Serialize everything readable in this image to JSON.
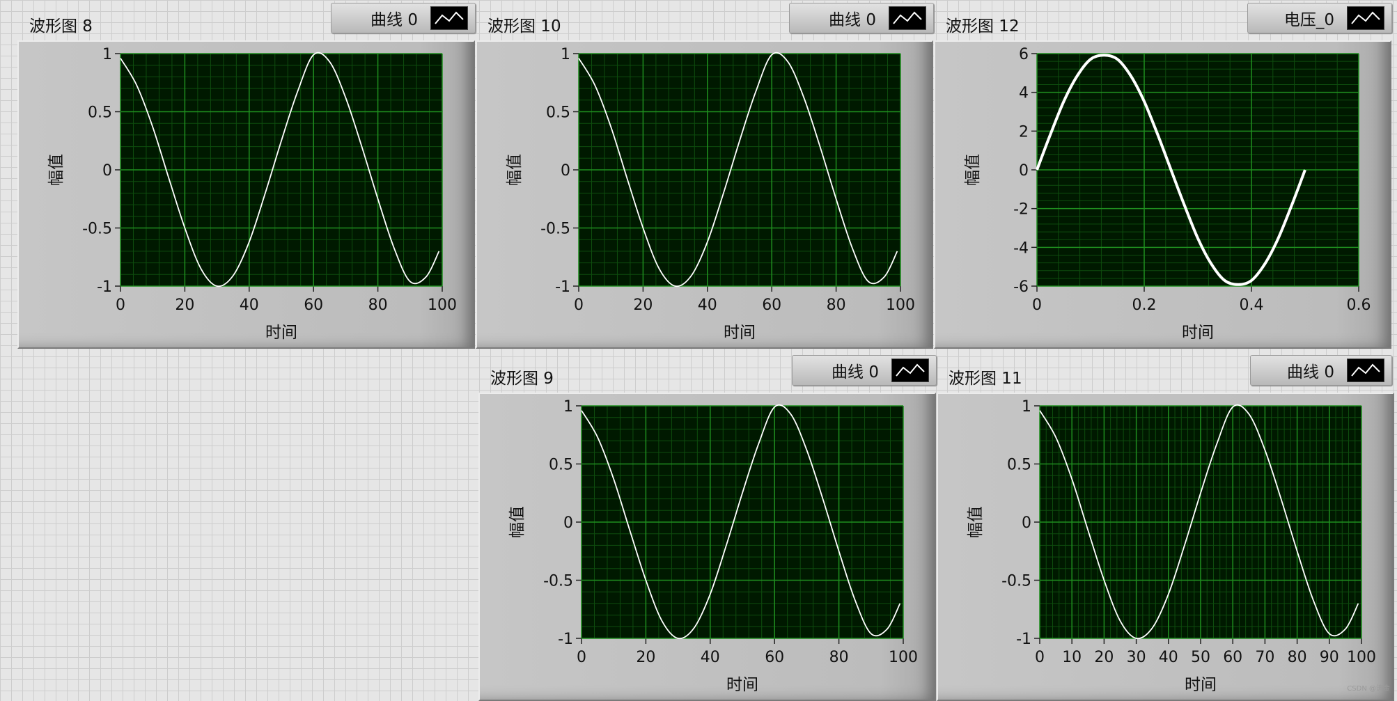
{
  "colors": {
    "plot_background": "#001900",
    "grid_major": "#1f8f1f",
    "grid_minor": "#0e4d0e",
    "trace": "#ffffff"
  },
  "graphs": [
    {
      "id": "g8",
      "label": "波形图 8",
      "legend": "曲线 0",
      "legend_icon": "line-plot-icon",
      "chart_data": {
        "type": "line",
        "xlabel": "时间",
        "ylabel": "幅值",
        "xlim": [
          0,
          100
        ],
        "ylim": [
          -1,
          1
        ],
        "xticks": [
          0,
          20,
          40,
          60,
          80,
          100
        ],
        "yticks": [
          -1,
          -0.5,
          0,
          0.5,
          1
        ],
        "xtick_labels": [
          "0",
          "20",
          "40",
          "60",
          "80",
          "100"
        ],
        "ytick_labels": [
          "-1",
          "-0.5",
          "0",
          "0.5",
          "1"
        ],
        "series": [
          {
            "x": [
              0,
              5,
              10,
              15,
              20,
              25,
              30,
              35,
              40,
              45,
              50,
              55,
              60,
              65,
              70,
              75,
              80,
              85,
              90,
              95,
              99
            ],
            "y": [
              0.96,
              0.73,
              0.37,
              -0.07,
              -0.5,
              -0.85,
              -1.0,
              -0.91,
              -0.62,
              -0.2,
              0.25,
              0.67,
              0.99,
              0.93,
              0.62,
              0.2,
              -0.25,
              -0.67,
              -0.96,
              -0.92,
              -0.7
            ]
          }
        ]
      }
    },
    {
      "id": "g10",
      "label": "波形图 10",
      "legend": "曲线 0",
      "legend_icon": "line-plot-icon",
      "chart_data": {
        "type": "line",
        "xlabel": "时间",
        "ylabel": "幅值",
        "xlim": [
          0,
          100
        ],
        "ylim": [
          -1,
          1
        ],
        "xticks": [
          0,
          20,
          40,
          60,
          80,
          100
        ],
        "yticks": [
          -1,
          -0.5,
          0,
          0.5,
          1
        ],
        "xtick_labels": [
          "0",
          "20",
          "40",
          "60",
          "80",
          "100"
        ],
        "ytick_labels": [
          "-1",
          "-0.5",
          "0",
          "0.5",
          "1"
        ],
        "series": [
          {
            "x": [
              0,
              5,
              10,
              15,
              20,
              25,
              30,
              35,
              40,
              45,
              50,
              55,
              60,
              65,
              70,
              75,
              80,
              85,
              90,
              95,
              99
            ],
            "y": [
              0.96,
              0.73,
              0.37,
              -0.07,
              -0.5,
              -0.85,
              -1.0,
              -0.91,
              -0.62,
              -0.2,
              0.25,
              0.67,
              0.99,
              0.93,
              0.62,
              0.2,
              -0.25,
              -0.67,
              -0.96,
              -0.92,
              -0.7
            ]
          }
        ]
      }
    },
    {
      "id": "g12",
      "label": "波形图 12",
      "legend": "电压_0",
      "legend_icon": "line-plot-icon",
      "chart_data": {
        "type": "line",
        "xlabel": "时间",
        "ylabel": "幅值",
        "xlim": [
          0,
          0.6
        ],
        "ylim": [
          -6,
          6
        ],
        "xticks": [
          0,
          0.2,
          0.4,
          0.6
        ],
        "yticks": [
          -6,
          -4,
          -2,
          0,
          2,
          4,
          6
        ],
        "xtick_labels": [
          "0",
          "0.2",
          "0.4",
          "0.6"
        ],
        "ytick_labels": [
          "-6",
          "-4",
          "-2",
          "0",
          "2",
          "4",
          "6"
        ],
        "series": [
          {
            "x": [
              0,
              0.025,
              0.05,
              0.075,
              0.1,
              0.125,
              0.15,
              0.175,
              0.2,
              0.225,
              0.25,
              0.275,
              0.3,
              0.325,
              0.35,
              0.375,
              0.4,
              0.425,
              0.45,
              0.475,
              0.5
            ],
            "y": [
              0,
              1.83,
              3.53,
              4.85,
              5.71,
              5.92,
              5.71,
              4.85,
              3.53,
              1.83,
              0,
              -1.83,
              -3.53,
              -4.85,
              -5.71,
              -5.92,
              -5.71,
              -4.85,
              -3.53,
              -1.83,
              0
            ]
          }
        ]
      }
    },
    {
      "id": "g9",
      "label": "波形图 9",
      "legend": "曲线 0",
      "legend_icon": "line-plot-icon",
      "chart_data": {
        "type": "line",
        "xlabel": "时间",
        "ylabel": "幅值",
        "xlim": [
          0,
          100
        ],
        "ylim": [
          -1,
          1
        ],
        "xticks": [
          0,
          20,
          40,
          60,
          80,
          100
        ],
        "yticks": [
          -1,
          -0.5,
          0,
          0.5,
          1
        ],
        "xtick_labels": [
          "0",
          "20",
          "40",
          "60",
          "80",
          "100"
        ],
        "ytick_labels": [
          "-1",
          "-0.5",
          "0",
          "0.5",
          "1"
        ],
        "series": [
          {
            "x": [
              0,
              5,
              10,
              15,
              20,
              25,
              30,
              35,
              40,
              45,
              50,
              55,
              60,
              65,
              70,
              75,
              80,
              85,
              90,
              95,
              99
            ],
            "y": [
              0.96,
              0.73,
              0.37,
              -0.07,
              -0.5,
              -0.85,
              -1.0,
              -0.91,
              -0.62,
              -0.2,
              0.25,
              0.67,
              0.99,
              0.93,
              0.62,
              0.2,
              -0.25,
              -0.67,
              -0.96,
              -0.92,
              -0.7
            ]
          }
        ]
      }
    },
    {
      "id": "g11",
      "label": "波形图 11",
      "legend": "曲线 0",
      "legend_icon": "line-plot-icon",
      "chart_data": {
        "type": "line",
        "xlabel": "时间",
        "ylabel": "幅值",
        "xlim": [
          0,
          100
        ],
        "ylim": [
          -1,
          1
        ],
        "xticks": [
          0,
          10,
          20,
          30,
          40,
          50,
          60,
          70,
          80,
          90,
          100
        ],
        "yticks": [
          -1,
          -0.5,
          0,
          0.5,
          1
        ],
        "xtick_labels": [
          "0",
          "10",
          "20",
          "30",
          "40",
          "50",
          "60",
          "70",
          "80",
          "90",
          "100"
        ],
        "ytick_labels": [
          "-1",
          "-0.5",
          "0",
          "0.5",
          "1"
        ],
        "series": [
          {
            "x": [
              0,
              5,
              10,
              15,
              20,
              25,
              30,
              35,
              40,
              45,
              50,
              55,
              60,
              65,
              70,
              75,
              80,
              85,
              90,
              95,
              99
            ],
            "y": [
              0.96,
              0.73,
              0.37,
              -0.07,
              -0.5,
              -0.85,
              -1.0,
              -0.91,
              -0.62,
              -0.2,
              0.25,
              0.67,
              0.99,
              0.93,
              0.62,
              0.2,
              -0.25,
              -0.67,
              -0.96,
              -0.92,
              -0.7
            ]
          }
        ]
      }
    }
  ],
  "watermark": "CSDN @涛金"
}
